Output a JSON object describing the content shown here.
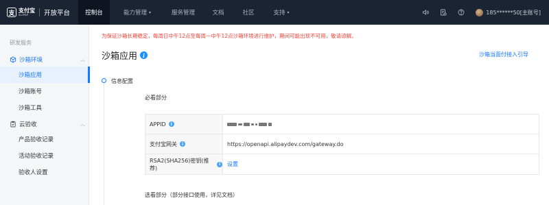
{
  "topnav": {
    "logo_mark": "支",
    "logo_text": "支付宝",
    "logo_sub": "ALIPAY",
    "platform": "开放平台",
    "items": [
      {
        "label": "控制台",
        "dropdown": false
      },
      {
        "label": "能力管理",
        "dropdown": true
      },
      {
        "label": "服务管理",
        "dropdown": false
      },
      {
        "label": "文档",
        "dropdown": false
      },
      {
        "label": "社区",
        "dropdown": false
      },
      {
        "label": "支持",
        "dropdown": true
      }
    ],
    "caret": "▾",
    "user": "185******50[主账号]"
  },
  "sidebar": {
    "section": "研发服务",
    "groups": [
      {
        "label": "沙箱环境",
        "chevron": "︿"
      },
      {
        "label": "云验收",
        "chevron": "︿"
      }
    ],
    "items": [
      {
        "label": "沙箱应用"
      },
      {
        "label": "沙箱账号"
      },
      {
        "label": "沙箱工具"
      },
      {
        "label": "产品验收记录"
      },
      {
        "label": "活动验收记录"
      },
      {
        "label": "验收人设置"
      }
    ]
  },
  "main": {
    "notice": "为保证沙箱长期稳定，每周日中午12点至每周一中午12点沙箱环境进行维护，期间可能出现不可用，敬请谅解。",
    "title": "沙箱应用",
    "info_glyph": "i",
    "guide_link": "沙箱当面付接入引导",
    "step_title": "信息配置",
    "required_label": "必看部分",
    "rows": [
      {
        "key": "APPID",
        "value": ""
      },
      {
        "key": "支付宝网关",
        "value": "https://openapi.alipaydev.com/gateway.do"
      },
      {
        "key": "RSA2(SHA256)密钥(推荐)",
        "value": "设置"
      }
    ],
    "optional_label": "选看部分（部分接口使用，详见文档）"
  },
  "colors": {
    "nav_bg": "#1b2433",
    "accent": "#1677ff",
    "notice": "#f04134"
  }
}
